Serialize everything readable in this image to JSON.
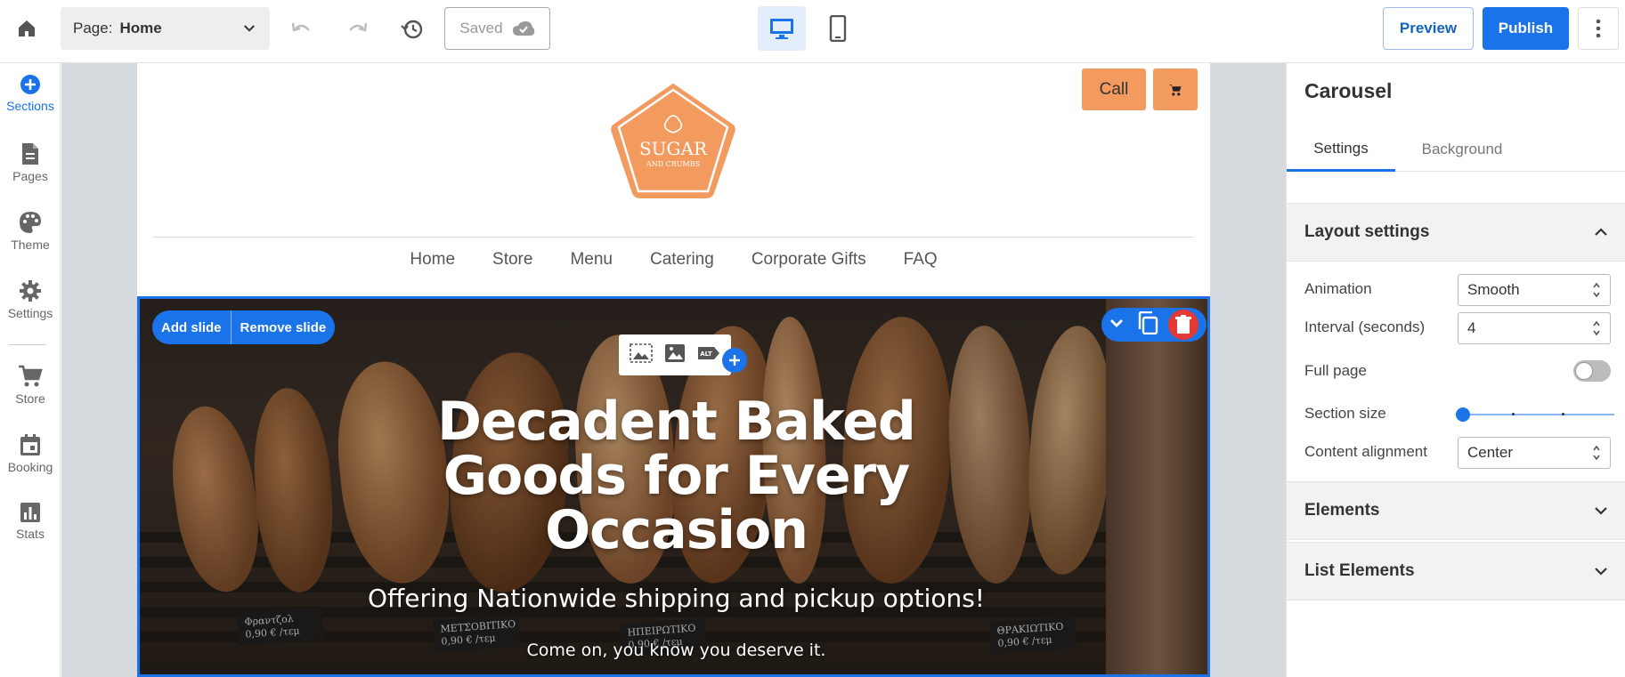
{
  "topbar": {
    "page_label": "Page:",
    "page_value": "Home",
    "saved_label": "Saved",
    "preview_label": "Preview",
    "publish_label": "Publish"
  },
  "leftrail": {
    "items": [
      {
        "label": "Sections",
        "icon": "plus-circle-icon"
      },
      {
        "label": "Pages",
        "icon": "page-icon"
      },
      {
        "label": "Theme",
        "icon": "palette-icon"
      },
      {
        "label": "Settings",
        "icon": "gear-icon"
      },
      {
        "label": "Store",
        "icon": "cart-icon"
      },
      {
        "label": "Booking",
        "icon": "calendar-icon"
      },
      {
        "label": "Stats",
        "icon": "chart-icon"
      }
    ]
  },
  "site": {
    "call_label": "Call",
    "logo_text_1": "SUGAR",
    "logo_text_2": "AND CRUMBS",
    "nav": [
      "Home",
      "Store",
      "Menu",
      "Catering",
      "Corporate Gifts",
      "FAQ"
    ],
    "carousel": {
      "add_slide": "Add slide",
      "remove_slide": "Remove slide",
      "title_lines": [
        "Decadent Baked",
        "Goods for Every",
        "Occasion"
      ],
      "subtitle": "Offering Nationwide shipping and pickup options!",
      "tagline": "Come on, you know you deserve it."
    }
  },
  "panel": {
    "title": "Carousel",
    "tabs": [
      "Settings",
      "Background"
    ],
    "layout_title": "Layout settings",
    "animation_label": "Animation",
    "animation_value": "Smooth",
    "interval_label": "Interval (seconds)",
    "interval_value": "4",
    "fullpage_label": "Full page",
    "section_size_label": "Section size",
    "content_alignment_label": "Content alignment",
    "content_alignment_value": "Center",
    "elements_title": "Elements",
    "list_elements_title": "List Elements"
  },
  "colors": {
    "accent": "#1a73e8",
    "brand_orange": "#f39a5e",
    "delete_red": "#e53935"
  }
}
